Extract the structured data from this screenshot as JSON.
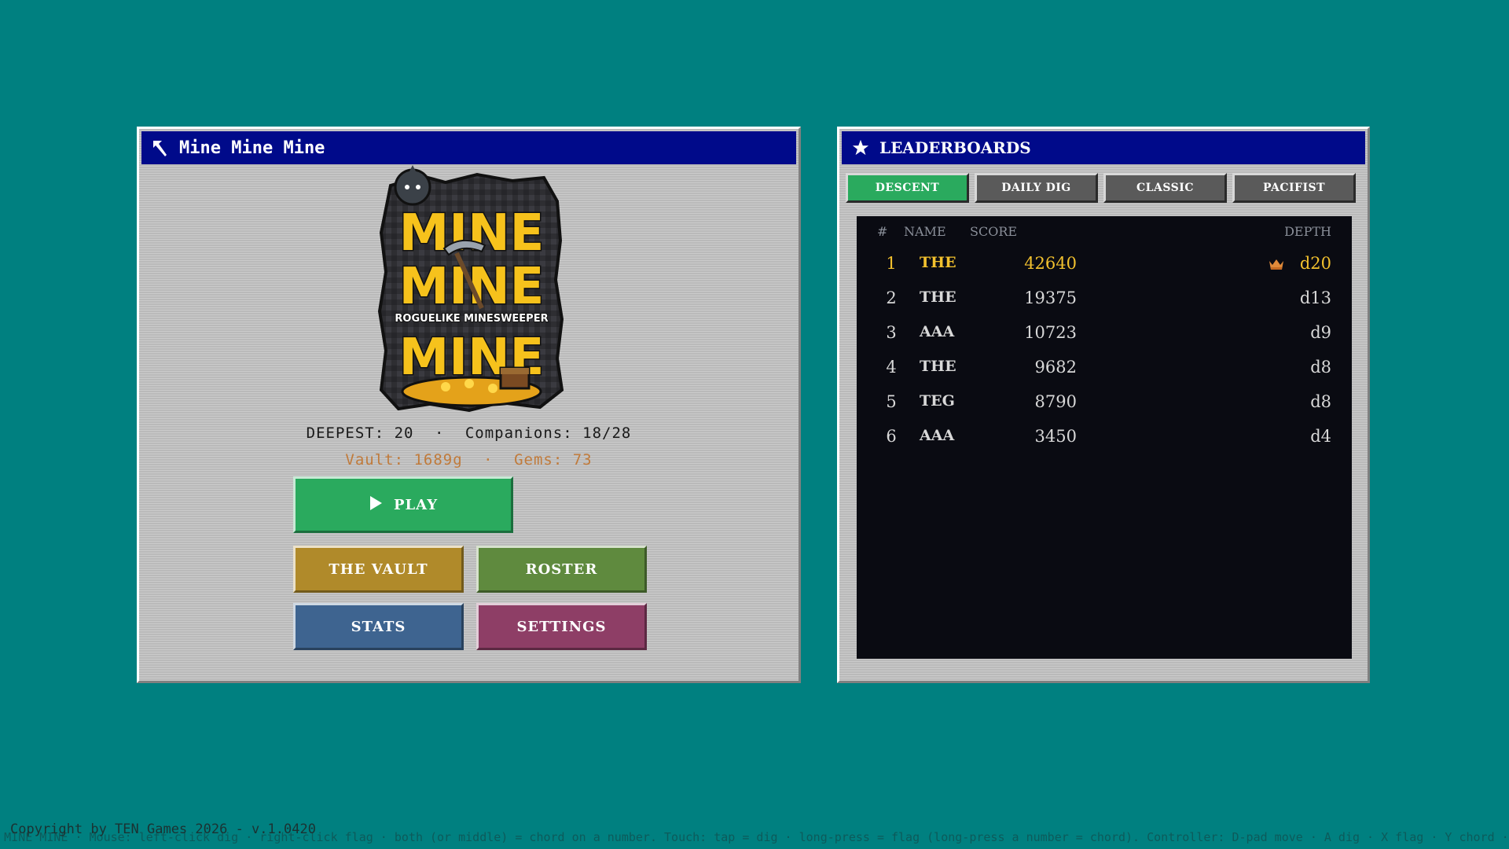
{
  "main_window": {
    "title": "Mine Mine Mine",
    "icon": "pickaxe-icon",
    "logo": {
      "line1": "MINE",
      "line2": "MINE",
      "tagline": "ROGUELIKE MINESWEEPER",
      "line3": "MINE"
    },
    "stats": {
      "deepest": "DEEPEST: 20",
      "companions": "Companions: 18/28",
      "vault": "Vault: 1689g",
      "gems": "Gems: 73",
      "separator": "·"
    },
    "buttons": {
      "play": "PLAY",
      "vault": "THE VAULT",
      "roster": "ROSTER",
      "stats": "STATS",
      "settings": "SETTINGS"
    }
  },
  "leaderboard_window": {
    "title": "LEADERBOARDS",
    "icon": "star-icon",
    "tabs": [
      "DESCENT",
      "DAILY DIG",
      "CLASSIC",
      "PACIFIST"
    ],
    "active_tab": "DESCENT",
    "columns": {
      "rank": "#",
      "name": "NAME",
      "score": "SCORE",
      "depth": "DEPTH"
    },
    "rows": [
      {
        "rank": "1",
        "name": "THE",
        "score": "42640",
        "depth": "d20",
        "crown": true
      },
      {
        "rank": "2",
        "name": "THE",
        "score": "19375",
        "depth": "d13"
      },
      {
        "rank": "3",
        "name": "AAA",
        "score": "10723",
        "depth": "d9"
      },
      {
        "rank": "4",
        "name": "THE",
        "score": "9682",
        "depth": "d8"
      },
      {
        "rank": "5",
        "name": "TEG",
        "score": "8790",
        "depth": "d8"
      },
      {
        "rank": "6",
        "name": "AAA",
        "score": "3450",
        "depth": "d4"
      }
    ]
  },
  "footer": {
    "copyright": "Copyright by TEN Games 2026 - v.1.0420",
    "help": "MINE MINE MINE · Mouse: left-click dig · right-click flag · both (or middle) = chord on a number. Touch: tap = dig · long-press = flag (long-press a number = chord). Controller: D-pad move · A dig · X flag · Y chord · LB/RB tools · B back"
  },
  "colors": {
    "desktop": "#008080",
    "title_bar": "#000a8a",
    "play": "#2aaa5e",
    "vault": "#b08a2a",
    "roster": "#5f8a3e",
    "stats": "#3e6490",
    "settings": "#8e3e66",
    "gold_text": "#f2c12e"
  }
}
